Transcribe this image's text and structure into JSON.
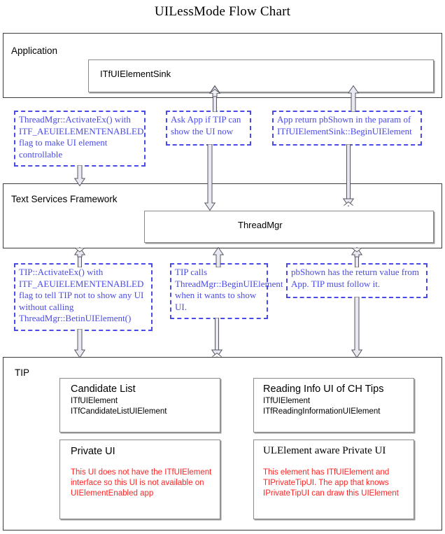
{
  "title": "UILessMode Flow Chart",
  "layers": [
    {
      "name": "application",
      "label": "Application"
    },
    {
      "name": "tsf",
      "label": "Text Services Framework"
    },
    {
      "name": "tip",
      "label": "TIP"
    }
  ],
  "components": {
    "sink": {
      "label": "ITfUIElementSink"
    },
    "threadmgr": {
      "label": "ThreadMgr"
    },
    "candidate_list": {
      "title": "Candidate List",
      "lines": [
        "ITfUIElement",
        "ITfCandidateListUIElement"
      ]
    },
    "reading_info": {
      "title": "Reading Info UI of CH Tips",
      "lines": [
        "ITfUIElement",
        "ITfReadingInformationUIElement"
      ]
    },
    "private_ui": {
      "title": "Private UI",
      "note": "This UI does not have the ITfUIElement interface so this UI is not available on UIElementEnabled app"
    },
    "ulelement_private_ui": {
      "title": "ULElement aware Private UI",
      "note": "This element has ITfUIElement and TIPrivateTipUI. The app that knows IPrivateTipUI can draw this UIElement"
    }
  },
  "notes": {
    "activateex_threadmgr": "ThreadMgr::ActivateEx() with ITF_AEUIELEMENTENABLED flag to make UI element controllable",
    "ask_app": "Ask App if TIP can show the UI now",
    "app_return_pbshown": "App return pbShown in the param of ITfUIElementSink::BeginUIElement",
    "activateex_tip": "TIP::ActivateEx() with ITF_AEUIELEMENTENABLED flag to tell TIP not to show any UI without calling ThreadMgr::BetinUIElement()",
    "tip_calls_beginuielement": "TIP calls ThreadMgr::BeginUIElement when it wants to show UI.",
    "pbshown_return": "pbShown has the return value from App. TIP must follow it."
  },
  "colors": {
    "note_blue": "#4a4ae8",
    "red_text": "#ff2222",
    "box_border": "#3c3c3c",
    "inner_border": "#8a8a8a",
    "arrow_fill": "#e8e8f0",
    "arrow_stroke": "#55555f"
  },
  "arrows": [
    {
      "name": "app-sink-up-notched",
      "direction": "up",
      "head": "notched"
    },
    {
      "name": "app-sink-up-solid",
      "direction": "up",
      "head": "solid"
    },
    {
      "name": "tsf-top-down-solid",
      "direction": "down",
      "head": "solid"
    },
    {
      "name": "threadmgr-down-solid",
      "direction": "down",
      "head": "solid"
    },
    {
      "name": "threadmgr-down-notched",
      "direction": "down",
      "head": "notched"
    },
    {
      "name": "tsf-bottom-up-notched-left",
      "direction": "up",
      "head": "notched"
    },
    {
      "name": "tsf-bottom-up-solid-mid",
      "direction": "up",
      "head": "solid"
    },
    {
      "name": "tsf-bottom-up-notched-right",
      "direction": "up",
      "head": "notched"
    },
    {
      "name": "tip-top-down-solid-left",
      "direction": "down",
      "head": "solid"
    },
    {
      "name": "tip-top-up-notched-mid",
      "direction": "down",
      "head": "notched"
    },
    {
      "name": "tip-top-down-solid-right",
      "direction": "down",
      "head": "solid"
    }
  ]
}
